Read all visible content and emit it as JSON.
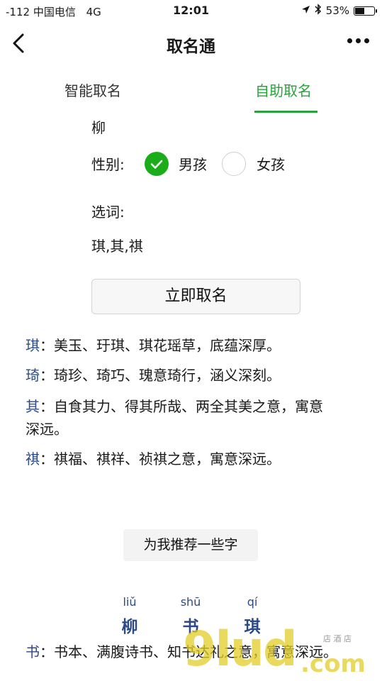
{
  "status_bar": {
    "signal": "-112",
    "carrier": "中国电信",
    "network": "4G",
    "time": "12:01",
    "battery_text": "53%",
    "battery_level": 0.53
  },
  "nav": {
    "title": "取名通"
  },
  "tabs": {
    "smart": "智能取名",
    "self": "自助取名",
    "active": "self"
  },
  "form": {
    "surname": "柳",
    "gender_label": "性别:",
    "gender_options": [
      {
        "label": "男孩",
        "selected": true
      },
      {
        "label": "女孩",
        "selected": false
      }
    ],
    "words_label": "选词:",
    "words_value": "琪,其,祺",
    "submit_label": "立即取名"
  },
  "meanings": [
    {
      "char": "琪",
      "sep": "：",
      "text": "美玉、玗琪、琪花瑶草，底蕴深厚。"
    },
    {
      "char": "琦",
      "sep": "：",
      "text": "琦珍、琦巧、瑰意琦行，涵义深刻。"
    },
    {
      "char": "其",
      "sep": "：",
      "text": "自食其力、得其所哉、两全其美之意，寓意深远。"
    },
    {
      "char": "祺",
      "sep": "：",
      "text": "祺福、祺祥、祯祺之意，寓意深远。"
    }
  ],
  "recommend_label": "为我推荐一些字",
  "result": {
    "chars": [
      {
        "pinyin": "liǔ",
        "hanzi": "柳"
      },
      {
        "pinyin": "shū",
        "hanzi": "书"
      },
      {
        "pinyin": "qí",
        "hanzi": "琪"
      }
    ],
    "meaning_char": "书",
    "meaning_sep": "：",
    "meaning_text": "书本、满腹诗书、知书达礼之意，寓意深远。"
  },
  "watermark": {
    "big": "9lud",
    "tld": ".com",
    "small": "店 酒 店"
  },
  "colors": {
    "accent_green": "#2aa33c",
    "check_green": "#1aad19",
    "char_blue": "#2b4a86"
  }
}
